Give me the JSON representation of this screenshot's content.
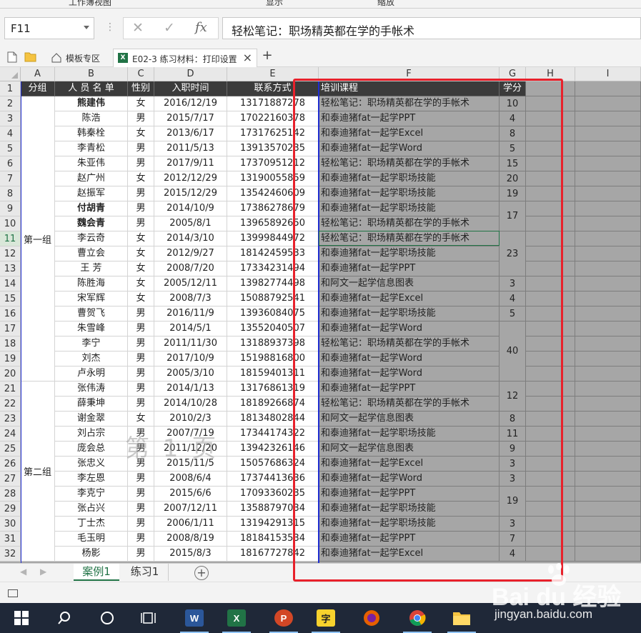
{
  "ribbon": {
    "labels": [
      "工作簿视图",
      "显示",
      "缩放"
    ]
  },
  "formula_bar": {
    "name_box": "F11",
    "formula": "轻松笔记：职场精英都在学的手帐术",
    "fx": "fx"
  },
  "doc_tabs": {
    "template": "模板专区",
    "file": "E02-3 练习材料：打印设置",
    "add": "+"
  },
  "columns": [
    "A",
    "B",
    "C",
    "D",
    "E",
    "F",
    "G",
    "H",
    "I"
  ],
  "table": {
    "headers": {
      "group": "分组",
      "name": "人 员 名 单",
      "gender": "性别",
      "date": "入职时间",
      "phone": "联系方式",
      "course": "培训课程",
      "credit": "学分"
    },
    "groups": [
      {
        "label": "第一组",
        "first_row": 2,
        "last_row": 20
      },
      {
        "label": "第二组",
        "first_row": 21,
        "last_row": 32
      }
    ],
    "rows": [
      {
        "num": "2",
        "name": "熊建伟",
        "gender": "女",
        "date": "2016/12/19",
        "phone": "13171887278",
        "course": "轻松笔记：职场精英都在学的手帐术",
        "bold": true
      },
      {
        "num": "3",
        "name": "陈浩",
        "gender": "男",
        "date": "2015/7/17",
        "phone": "17022160378",
        "course": "和泰迪猪fat一起学PPT"
      },
      {
        "num": "4",
        "name": "韩秦栓",
        "gender": "女",
        "date": "2013/6/17",
        "phone": "17317625142",
        "course": "和泰迪猪fat一起学Excel"
      },
      {
        "num": "5",
        "name": "李青松",
        "gender": "男",
        "date": "2011/5/13",
        "phone": "13913570235",
        "course": "和泰迪猪fat一起学Word"
      },
      {
        "num": "6",
        "name": "朱亚伟",
        "gender": "男",
        "date": "2017/9/11",
        "phone": "17370951212",
        "course": "轻松笔记：职场精英都在学的手帐术"
      },
      {
        "num": "7",
        "name": "赵广州",
        "gender": "女",
        "date": "2012/12/29",
        "phone": "13190055859",
        "course": "和泰迪猪fat一起学职场技能"
      },
      {
        "num": "8",
        "name": "赵振军",
        "gender": "男",
        "date": "2015/12/29",
        "phone": "13542460609",
        "course": "和泰迪猪fat一起学职场技能"
      },
      {
        "num": "9",
        "name": "付胡青",
        "gender": "男",
        "date": "2014/10/9",
        "phone": "17386278679",
        "course": "和泰迪猪fat一起学职场技能",
        "bold": true
      },
      {
        "num": "10",
        "name": "魏会青",
        "gender": "男",
        "date": "2005/8/1",
        "phone": "13965892650",
        "course": "轻松笔记：职场精英都在学的手帐术",
        "bold": true
      },
      {
        "num": "11",
        "name": "李云奇",
        "gender": "女",
        "date": "2014/3/10",
        "phone": "13999844972",
        "course": "轻松笔记：职场精英都在学的手帐术"
      },
      {
        "num": "12",
        "name": "曹立会",
        "gender": "女",
        "date": "2012/9/27",
        "phone": "18142459533",
        "course": "和泰迪猪fat一起学职场技能"
      },
      {
        "num": "13",
        "name": "王  芳",
        "gender": "女",
        "date": "2008/7/20",
        "phone": "17334231494",
        "course": "和泰迪猪fat一起学PPT"
      },
      {
        "num": "14",
        "name": "陈胜海",
        "gender": "女",
        "date": "2005/12/11",
        "phone": "13982774498",
        "course": "和阿文一起学信息图表"
      },
      {
        "num": "15",
        "name": "宋军辉",
        "gender": "女",
        "date": "2008/7/3",
        "phone": "15088792541",
        "course": "和泰迪猪fat一起学Excel"
      },
      {
        "num": "16",
        "name": "曹贺飞",
        "gender": "男",
        "date": "2016/11/9",
        "phone": "13936084075",
        "course": "和泰迪猪fat一起学职场技能"
      },
      {
        "num": "17",
        "name": "朱雪峰",
        "gender": "男",
        "date": "2014/5/1",
        "phone": "13552040507",
        "course": "和泰迪猪fat一起学Word"
      },
      {
        "num": "18",
        "name": "李宁",
        "gender": "男",
        "date": "2011/11/30",
        "phone": "13188937398",
        "course": "轻松笔记：职场精英都在学的手帐术"
      },
      {
        "num": "19",
        "name": "刘杰",
        "gender": "男",
        "date": "2017/10/9",
        "phone": "15198816800",
        "course": "和泰迪猪fat一起学Word"
      },
      {
        "num": "20",
        "name": "卢永明",
        "gender": "男",
        "date": "2005/3/10",
        "phone": "18159401311",
        "course": "和泰迪猪fat一起学Word"
      },
      {
        "num": "21",
        "name": "张伟涛",
        "gender": "男",
        "date": "2014/1/13",
        "phone": "13176861319",
        "course": "和泰迪猪fat一起学PPT"
      },
      {
        "num": "22",
        "name": "薛秉坤",
        "gender": "男",
        "date": "2014/10/28",
        "phone": "18189266874",
        "course": "轻松笔记：职场精英都在学的手帐术"
      },
      {
        "num": "23",
        "name": "谢金翠",
        "gender": "女",
        "date": "2010/2/3",
        "phone": "18134802844",
        "course": "和阿文一起学信息图表"
      },
      {
        "num": "24",
        "name": "刘占宗",
        "gender": "男",
        "date": "2007/7/19",
        "phone": "17344174322",
        "course": "和泰迪猪fat一起学职场技能"
      },
      {
        "num": "25",
        "name": "庞会总",
        "gender": "男",
        "date": "2011/12/20",
        "phone": "13942326146",
        "course": "和阿文一起学信息图表"
      },
      {
        "num": "26",
        "name": "张忠义",
        "gender": "男",
        "date": "2015/11/5",
        "phone": "15057686324",
        "course": "和泰迪猪fat一起学Excel"
      },
      {
        "num": "27",
        "name": "李左恩",
        "gender": "男",
        "date": "2008/6/4",
        "phone": "17374413636",
        "course": "和泰迪猪fat一起学Word"
      },
      {
        "num": "28",
        "name": "李克宁",
        "gender": "男",
        "date": "2015/6/6",
        "phone": "17093360235",
        "course": "和泰迪猪fat一起学PPT"
      },
      {
        "num": "29",
        "name": "张占兴",
        "gender": "男",
        "date": "2007/12/11",
        "phone": "13588797034",
        "course": "和泰迪猪fat一起学职场技能"
      },
      {
        "num": "30",
        "name": "丁士杰",
        "gender": "男",
        "date": "2006/1/11",
        "phone": "13194291315",
        "course": "和泰迪猪fat一起学职场技能"
      },
      {
        "num": "31",
        "name": "毛玉明",
        "gender": "男",
        "date": "2008/8/19",
        "phone": "18184153534",
        "course": "和泰迪猪fat一起学PPT"
      },
      {
        "num": "32",
        "name": "杨影",
        "gender": "男",
        "date": "2015/8/3",
        "phone": "18167727842",
        "course": "和泰迪猪fat一起学Excel"
      }
    ],
    "credits": [
      {
        "value": "10",
        "first_row": 2,
        "last_row": 2
      },
      {
        "value": "4",
        "first_row": 3,
        "last_row": 3
      },
      {
        "value": "8",
        "first_row": 4,
        "last_row": 4
      },
      {
        "value": "5",
        "first_row": 5,
        "last_row": 5
      },
      {
        "value": "15",
        "first_row": 6,
        "last_row": 6
      },
      {
        "value": "20",
        "first_row": 7,
        "last_row": 7
      },
      {
        "value": "19",
        "first_row": 8,
        "last_row": 8
      },
      {
        "value": "17",
        "first_row": 9,
        "last_row": 10
      },
      {
        "value": "23",
        "first_row": 11,
        "last_row": 13
      },
      {
        "value": "3",
        "first_row": 14,
        "last_row": 14
      },
      {
        "value": "4",
        "first_row": 15,
        "last_row": 15
      },
      {
        "value": "5",
        "first_row": 16,
        "last_row": 16
      },
      {
        "value": "40",
        "first_row": 17,
        "last_row": 20
      },
      {
        "value": "12",
        "first_row": 21,
        "last_row": 22
      },
      {
        "value": "8",
        "first_row": 23,
        "last_row": 23
      },
      {
        "value": "11",
        "first_row": 24,
        "last_row": 24
      },
      {
        "value": "9",
        "first_row": 25,
        "last_row": 25
      },
      {
        "value": "3",
        "first_row": 26,
        "last_row": 26
      },
      {
        "value": "3",
        "first_row": 27,
        "last_row": 27
      },
      {
        "value": "19",
        "first_row": 28,
        "last_row": 29
      },
      {
        "value": "3",
        "first_row": 30,
        "last_row": 30
      },
      {
        "value": "7",
        "first_row": 31,
        "last_row": 31
      },
      {
        "value": "4",
        "first_row": 32,
        "last_row": 32
      }
    ]
  },
  "page_watermark": "第 1 页",
  "sheets": {
    "tabs": [
      "案例1",
      "练习1"
    ],
    "active": "案例1",
    "add": "+"
  },
  "taskbar": {
    "apps": [
      "start",
      "search",
      "cortana",
      "task-view",
      "word",
      "excel",
      "powerpoint",
      "zi",
      "firefox",
      "chrome",
      "explorer"
    ],
    "labels": {
      "word": "W",
      "excel": "X",
      "powerpoint": "P",
      "zi": "字"
    }
  },
  "brand_watermark": {
    "logo": "Bai du 经验",
    "url": "jingyan.baidu.com"
  },
  "colors": {
    "header_bg": "#3b3b3b",
    "excel_green": "#217346",
    "selection_red": "#e8212b",
    "page_break_blue": "#1f2dd0",
    "nonprint_gray": "#a6a6a6"
  }
}
